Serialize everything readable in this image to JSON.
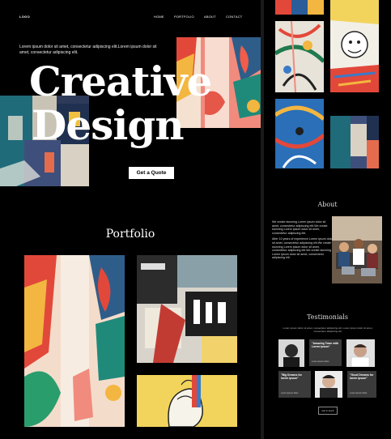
{
  "header": {
    "logo": "LOGO",
    "nav": [
      "HOME",
      "PORTFOLIO",
      "ABOUT",
      "CONTACT"
    ]
  },
  "hero": {
    "intro": "Lorem ipsum dolor sit amet, consectetur adipiscing elit.Lorem ipsum dolor sit amet, consectetur adipiscing elit.",
    "title_line1": "Creative",
    "title_line2": "Design",
    "cta_label": "Get a Quote"
  },
  "portfolio": {
    "title": "Portfolio"
  },
  "about": {
    "title": "About",
    "paragraph1": "We create stunning Lorem ipsum dolor sit amet, consectetur adipiscing elit.We create stunning Lorem ipsum dolor sit amet, consectetur adipiscing elit.",
    "paragraph2": "After 10 years of experience Lorem ipsum dolor sit amet, consectetur adipiscing elit.We create stunning Lorem ipsum dolor sit amet, consectetur adipiscing elit.We create stunning Lorem ipsum dolor sit amet, consectetur adipiscing elit."
  },
  "testimonials": {
    "title": "Testimonials",
    "subtitle": "Lorem ipsum dolor sit amet, consectetur adipiscing elit. Lorem ipsum dolor sit amet, consectetur adipiscing elit.",
    "quote1": "\"Amazing Team with Lorem Ipsum\"",
    "quote2": "\"Big Dreams for lorem ipsum\"",
    "quote3": "\"Good Dreams for lorem ipsum\"",
    "author": "Lorem ipsum dolor",
    "contact_label": "Get in touch"
  },
  "colors": {
    "background": "#000000",
    "button": "#ffffff",
    "card": "#3b3b3b",
    "accent_red": "#e8503a",
    "accent_yellow": "#f2c94c"
  }
}
